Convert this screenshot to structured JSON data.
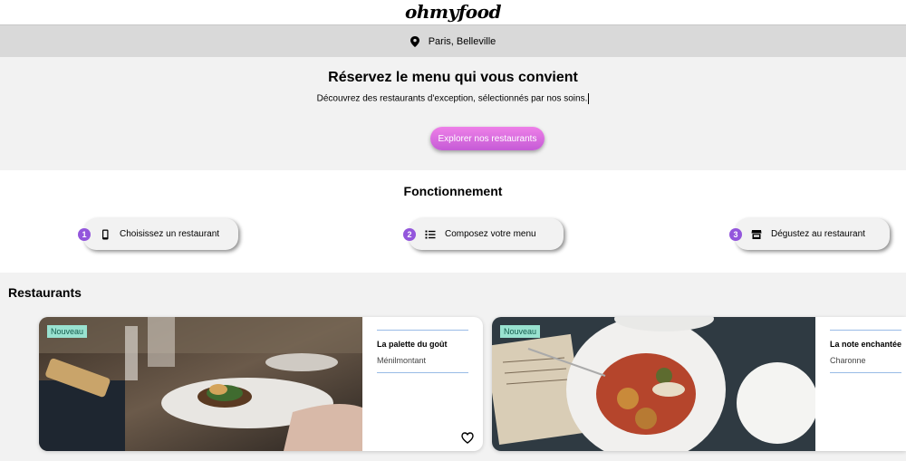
{
  "app": {
    "logo": "ohmyfood"
  },
  "location": {
    "text": "Paris, Belleville",
    "icon": "map-pin-icon"
  },
  "hero": {
    "title": "Réservez le menu qui vous convient",
    "subtitle": "Découvrez des restaurants d'exception, sélectionnés par nos soins.",
    "button_label": "Explorer nos restaurants",
    "button_colors": [
      "#ee80e8",
      "#c55bd6"
    ]
  },
  "how_it_works": {
    "title": "Fonctionnement",
    "steps": [
      {
        "number": "1",
        "label": "Choisissez un restaurant",
        "icon": "mobile-phone-icon"
      },
      {
        "number": "2",
        "label": "Composez votre menu",
        "icon": "list-icon"
      },
      {
        "number": "3",
        "label": "Dégustez au restaurant",
        "icon": "store-icon"
      }
    ],
    "accent": "#9356dc"
  },
  "restaurants": {
    "title": "Restaurants",
    "cards": [
      {
        "badge": "Nouveau",
        "name": "La palette du goût",
        "area": "Ménilmontant",
        "favorite_icon": "heart-outline-icon"
      },
      {
        "badge": "Nouveau",
        "name": "La note enchantée",
        "area": "Charonne",
        "favorite_icon": "heart-outline-icon"
      }
    ],
    "badge_color": "#99e2d0"
  }
}
